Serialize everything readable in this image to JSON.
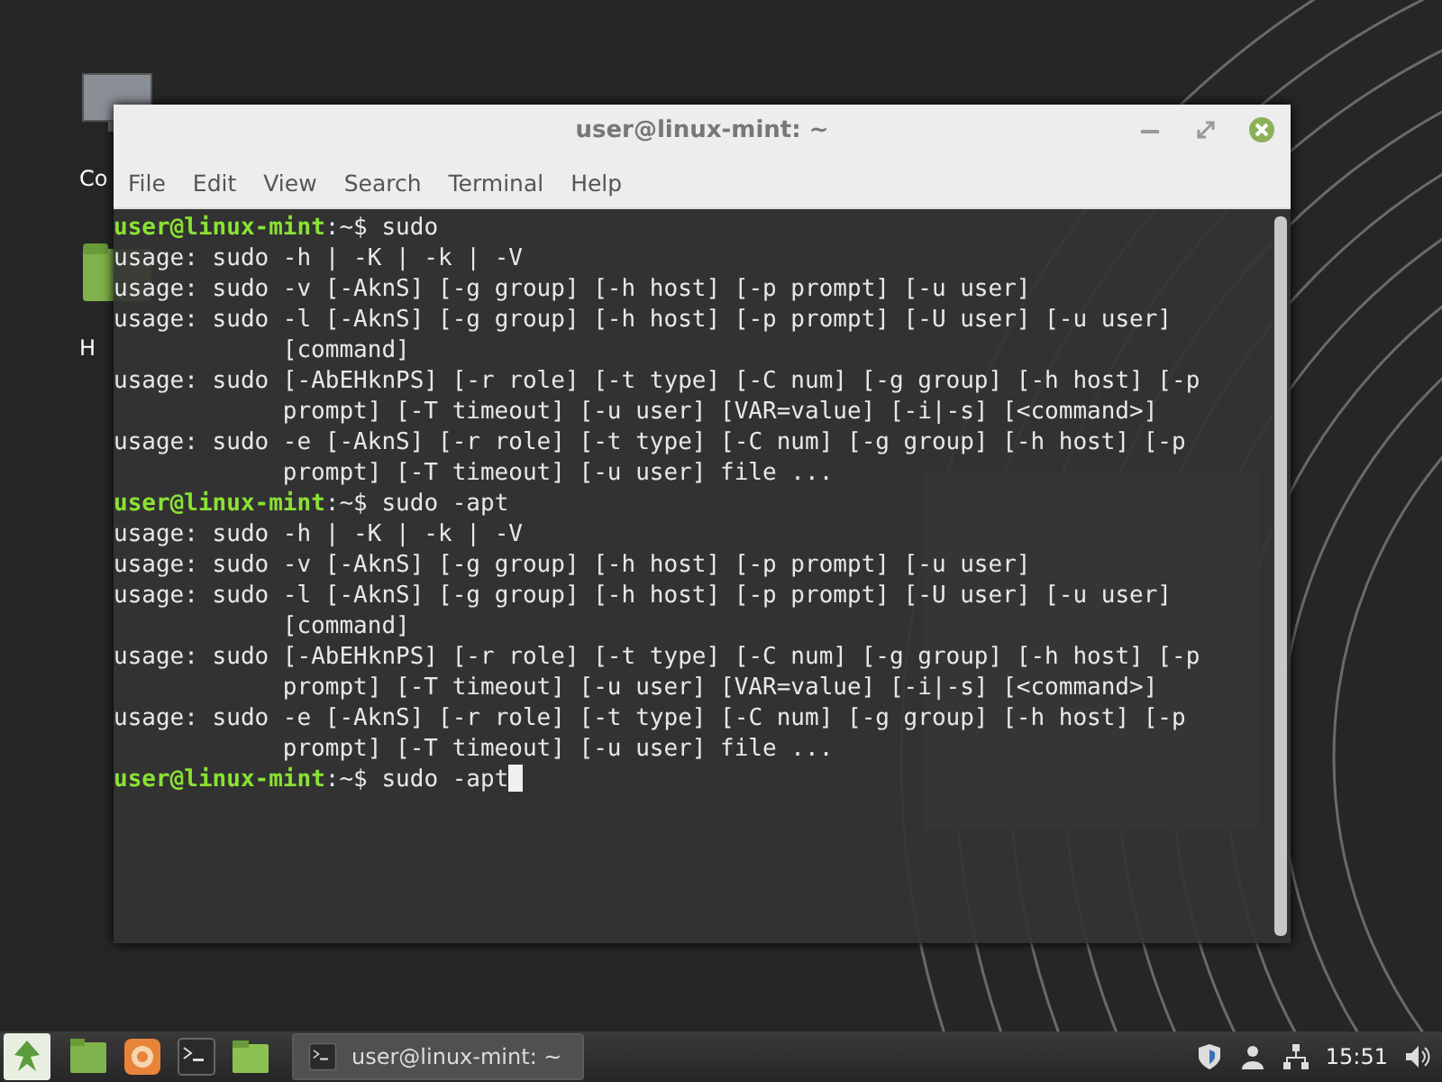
{
  "desktop": {
    "icons": [
      {
        "kind": "computer",
        "label": "Co"
      },
      {
        "kind": "home",
        "label": "H"
      }
    ]
  },
  "window": {
    "title": "user@linux-mint: ~",
    "menu": [
      "File",
      "Edit",
      "View",
      "Search",
      "Terminal",
      "Help"
    ],
    "lines": [
      {
        "kind": "prompt",
        "user": "user@linux-mint",
        "path": ":~$",
        "command": "sudo",
        "cursor": false
      },
      {
        "kind": "output",
        "text": "usage: sudo -h | -K | -k | -V"
      },
      {
        "kind": "output",
        "text": "usage: sudo -v [-AknS] [-g group] [-h host] [-p prompt] [-u user]"
      },
      {
        "kind": "output",
        "text": "usage: sudo -l [-AknS] [-g group] [-h host] [-p prompt] [-U user] [-u user]"
      },
      {
        "kind": "continuation",
        "text": "[command]"
      },
      {
        "kind": "output",
        "text": "usage: sudo [-AbEHknPS] [-r role] [-t type] [-C num] [-g group] [-h host] [-p"
      },
      {
        "kind": "continuation",
        "text": "prompt] [-T timeout] [-u user] [VAR=value] [-i|-s] [<command>]"
      },
      {
        "kind": "output",
        "text": "usage: sudo -e [-AknS] [-r role] [-t type] [-C num] [-g group] [-h host] [-p"
      },
      {
        "kind": "continuation",
        "text": "prompt] [-T timeout] [-u user] file ..."
      },
      {
        "kind": "prompt",
        "user": "user@linux-mint",
        "path": ":~$",
        "command": "sudo -apt",
        "cursor": false
      },
      {
        "kind": "output",
        "text": "usage: sudo -h | -K | -k | -V"
      },
      {
        "kind": "output",
        "text": "usage: sudo -v [-AknS] [-g group] [-h host] [-p prompt] [-u user]"
      },
      {
        "kind": "output",
        "text": "usage: sudo -l [-AknS] [-g group] [-h host] [-p prompt] [-U user] [-u user]"
      },
      {
        "kind": "continuation",
        "text": "[command]"
      },
      {
        "kind": "output",
        "text": "usage: sudo [-AbEHknPS] [-r role] [-t type] [-C num] [-g group] [-h host] [-p"
      },
      {
        "kind": "continuation",
        "text": "prompt] [-T timeout] [-u user] [VAR=value] [-i|-s] [<command>]"
      },
      {
        "kind": "output",
        "text": "usage: sudo -e [-AknS] [-r role] [-t type] [-C num] [-g group] [-h host] [-p"
      },
      {
        "kind": "continuation",
        "text": "prompt] [-T timeout] [-u user] file ..."
      },
      {
        "kind": "prompt",
        "user": "user@linux-mint",
        "path": ":~$",
        "command": "sudo -apt",
        "cursor": true
      }
    ]
  },
  "taskbar": {
    "launchers": [
      {
        "kind": "files"
      },
      {
        "kind": "browser"
      },
      {
        "kind": "terminal"
      },
      {
        "kind": "folder"
      }
    ],
    "window_button": "user@linux-mint: ~",
    "clock": "15:51"
  }
}
